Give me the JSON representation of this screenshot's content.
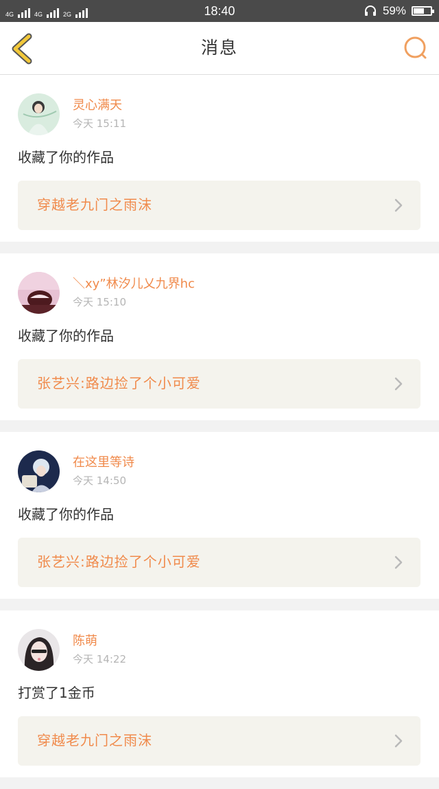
{
  "status_bar": {
    "network_left": "4G",
    "network_mid": "4G",
    "network_right": "2G",
    "time": "18:40",
    "battery_percent": "59%",
    "battery_level": 0.59,
    "icons": [
      "signal-icon",
      "headset-icon",
      "battery-icon"
    ]
  },
  "nav": {
    "title": "消息",
    "back_icon": "chevron-left-icon",
    "search_icon": "search-icon",
    "accent_color": "#f0a060"
  },
  "messages": [
    {
      "username": "灵心满天",
      "time": "今天 15:11",
      "action": "收藏了你的作品",
      "work_title": "穿越老九门之雨沫"
    },
    {
      "username": "＼xy”林汐儿乂九界hc",
      "time": "今天 15:10",
      "action": "收藏了你的作品",
      "work_title": "张艺兴:路边捡了个小可爱"
    },
    {
      "username": "在这里等诗",
      "time": "今天 14:50",
      "action": "收藏了你的作品",
      "work_title": "张艺兴:路边捡了个小可爱"
    },
    {
      "username": "陈萌",
      "time": "今天 14:22",
      "action": "打赏了1金币",
      "work_title": "穿越老九门之雨沫"
    }
  ],
  "colors": {
    "accent": "#f08a4b",
    "status_bar_bg": "#4a4a4a",
    "card_link_bg": "#f4f3ed",
    "page_bg": "#f2f2f2"
  }
}
